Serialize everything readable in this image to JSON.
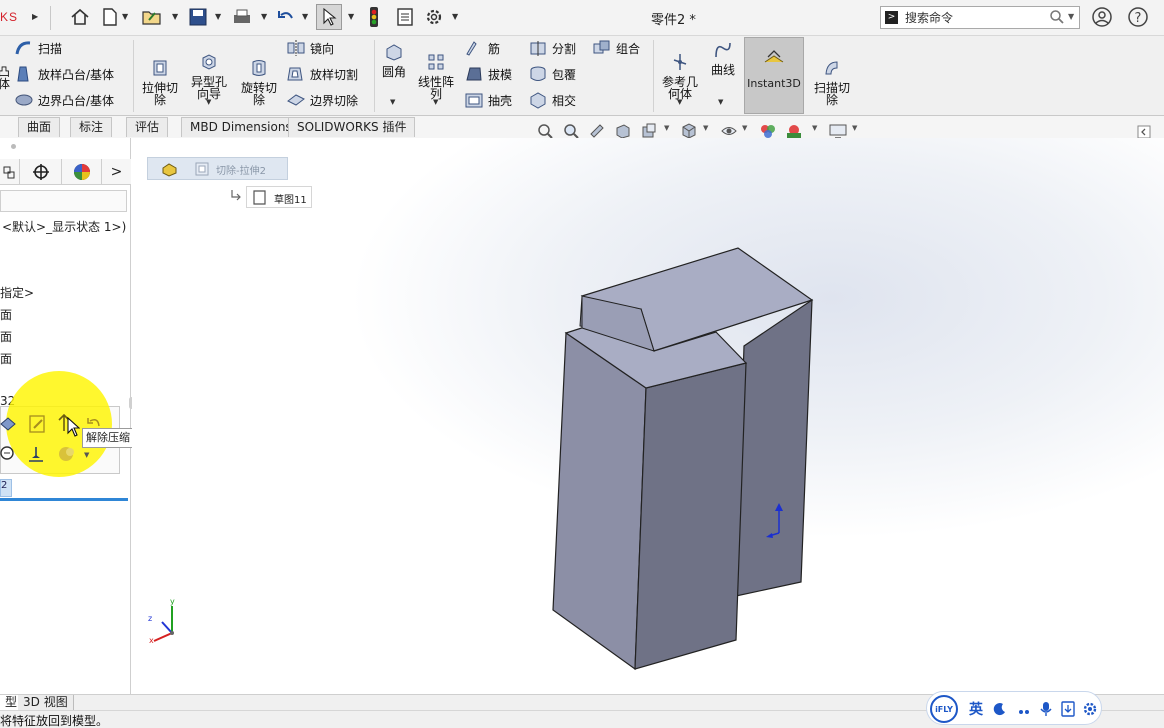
{
  "titlebar": {
    "logo_text": "KS",
    "document_title": "零件2 *",
    "search": {
      "placeholder": "搜索命令"
    }
  },
  "ribbon": {
    "sweep_boss": "扫描",
    "loft_boss": "放样凸台/基体",
    "boundary_boss": "边界凸台/基体",
    "boss_partial": "凸\n体",
    "extruded_cut": "拉伸切\n除",
    "hole_wizard": "异型孔\n向导",
    "revolved_cut": "旋转切\n除",
    "mirror": "镜向",
    "lofted_cut": "放样切割",
    "boundary_cut": "边界切除",
    "fillet": "圆角",
    "linear_pattern": "线性阵\n列",
    "rib": "筋",
    "draft": "拔模",
    "shell": "抽壳",
    "split": "分割",
    "wrap": "包覆",
    "intersect": "相交",
    "combine": "组合",
    "reference_geometry": "参考几\n何体",
    "curves": "曲线",
    "instant3d": "Instant3D",
    "swept_cut": "扫描切\n除"
  },
  "tabs": [
    "曲面",
    "标注",
    "评估",
    "MBD Dimensions",
    "SOLIDWORKS 插件"
  ],
  "left_panel": {
    "config_text": "<默认>_显示状态 1>)",
    "material_text": "指定>",
    "plane_1": "面",
    "plane_2": "面",
    "plane_3": "面",
    "feature_partial": "32",
    "bottom_tab": "2",
    "tooltip": "解除压缩"
  },
  "viewport": {
    "breadcrumb_feature": "切除-拉伸2",
    "breadcrumb_sketch": "草图11",
    "triad": {
      "x": "x",
      "y": "y",
      "z": "z"
    }
  },
  "bottom_tabs": [
    "型",
    "3D 视图"
  ],
  "status": {
    "message": "将特征放回到模型。"
  },
  "ime": {
    "brand": "iFLY",
    "lang": "英"
  },
  "colors": {
    "model_face_left": "#8c8fa6",
    "model_face_right": "#6f7286",
    "model_face_top": "#a9adc4",
    "highlight": "#fff200",
    "active_tab_line": "#2f86d6"
  }
}
